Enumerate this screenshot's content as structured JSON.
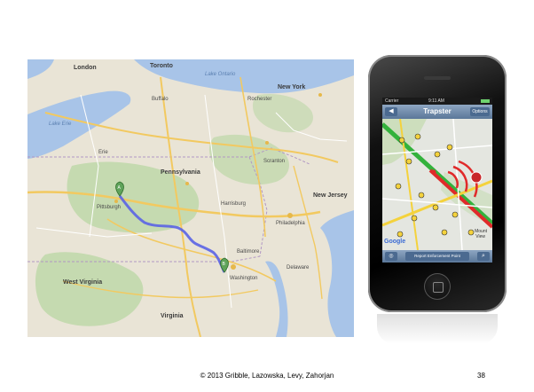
{
  "map": {
    "labels": {
      "london": "London",
      "toronto": "Toronto",
      "rochester": "Rochester",
      "new_york": "New York",
      "buffalo": "Buffalo",
      "erie": "Erie",
      "scranton": "Scranton",
      "pittsburgh": "Pittsburgh",
      "harrisburg": "Harrisburg",
      "philadelphia": "Philadelphia",
      "baltimore": "Baltimore",
      "washington": "Washington",
      "pennsylvania": "Pennsylvania",
      "lake_ontario": "Lake Ontario",
      "lake_erie": "Lake Erie",
      "west_virginia": "West Virginia",
      "virginia": "Virginia",
      "delaware": "Delaware",
      "new_jersey": "New Jersey"
    },
    "colors": {
      "route": "#5a63e6",
      "land": "#e9e4d6",
      "water": "#a8c4e8",
      "forest": "#bcd7a6",
      "highway": "#f2c960",
      "marker": "#5fa35a"
    },
    "markers": [
      "A",
      "B"
    ]
  },
  "phone": {
    "status": {
      "carrier": "Carrier",
      "time": "9:11 AM"
    },
    "nav": {
      "back_icon": "◀",
      "title": "Trapster",
      "options": "Options"
    },
    "toolbar": {
      "left_icon": "◎",
      "report": "Report Enforcement Point",
      "search_icon": "⌕"
    },
    "map_labels": {
      "google": "Google",
      "mountain": "Mount",
      "view": "View"
    },
    "colors": {
      "road_green": "#33b23c",
      "road_red": "#e02a2a",
      "road_yellow": "#f4d23c"
    }
  },
  "footer": {
    "copyright": "© 2013 Gribble, Lazowska, Levy, Zahorjan",
    "slide_number": "38"
  }
}
